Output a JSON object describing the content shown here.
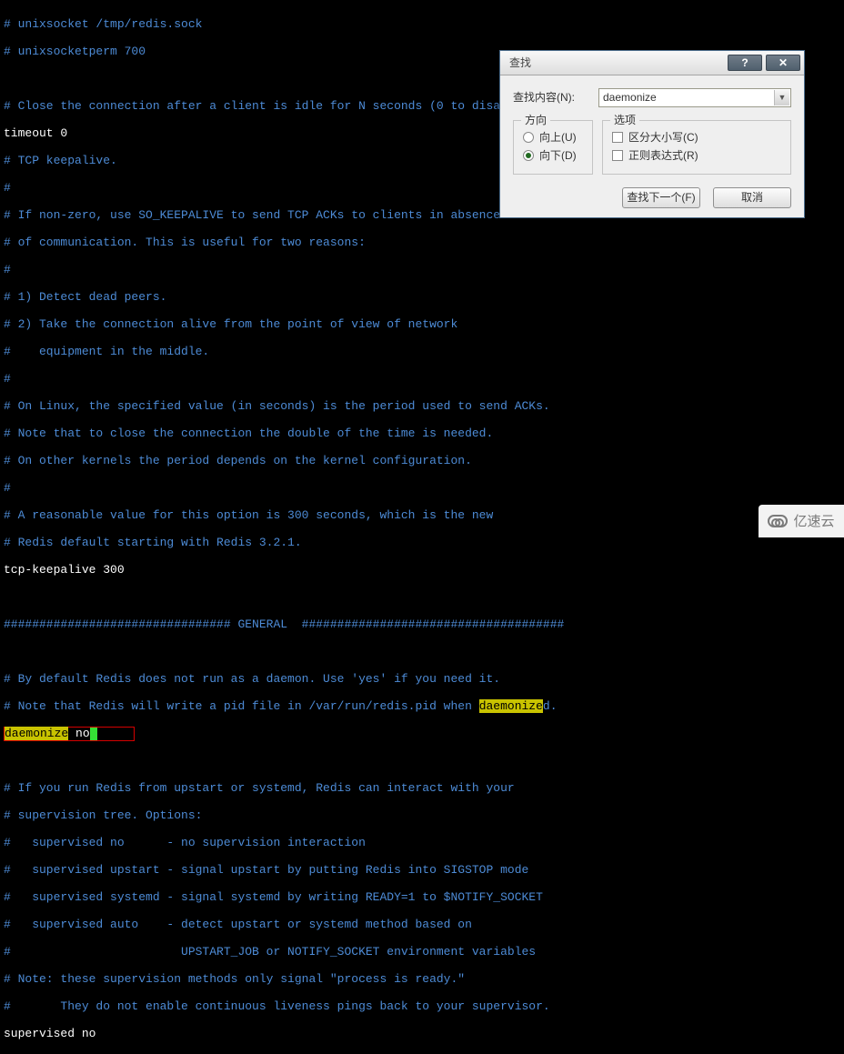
{
  "terminal": {
    "l1": "# unixsocket /tmp/redis.sock",
    "l2": "# unixsocketperm 700",
    "l3": "",
    "l4": "# Close the connection after a client is idle for N seconds (0 to disable)",
    "l5": "timeout 0",
    "l6": "# TCP keepalive.",
    "l7": "#",
    "l8": "# If non-zero, use SO_KEEPALIVE to send TCP ACKs to clients in absence",
    "l9": "# of communication. This is useful for two reasons:",
    "l10": "#",
    "l11": "# 1) Detect dead peers.",
    "l12": "# 2) Take the connection alive from the point of view of network",
    "l13": "#    equipment in the middle.",
    "l14": "#",
    "l15": "# On Linux, the specified value (in seconds) is the period used to send ACKs.",
    "l16": "# Note that to close the connection the double of the time is needed.",
    "l17": "# On other kernels the period depends on the kernel configuration.",
    "l18": "#",
    "l19": "# A reasonable value for this option is 300 seconds, which is the new",
    "l20": "# Redis default starting with Redis 3.2.1.",
    "l21": "tcp-keepalive 300",
    "l22": "",
    "divider": "################################ GENERAL  #####################################",
    "l24": "",
    "l25": "# By default Redis does not run as a daemon. Use 'yes' if you need it.",
    "l26a": "# Note that Redis will write a pid file in /var/run/redis.pid when ",
    "l26b": "daemonize",
    "l26c": "d.",
    "l27a": "daemonize",
    "l27b": " no",
    "l28": "",
    "l29": "# If you run Redis from upstart or systemd, Redis can interact with your",
    "l30": "# supervision tree. Options:",
    "l31": "#   supervised no      - no supervision interaction",
    "l32": "#   supervised upstart - signal upstart by putting Redis into SIGSTOP mode",
    "l33": "#   supervised systemd - signal systemd by writing READY=1 to $NOTIFY_SOCKET",
    "l34": "#   supervised auto    - detect upstart or systemd method based on",
    "l35": "#                        UPSTART_JOB or NOTIFY_SOCKET environment variables",
    "l36": "# Note: these supervision methods only signal \"process is ready.\"",
    "l37": "#       They do not enable continuous liveness pings back to your supervisor.",
    "l38": "supervised no"
  },
  "find": {
    "title": "查找",
    "help": "?",
    "close": "✕",
    "label_content": "查找内容(N):",
    "value": "daemonize",
    "group_direction": "方向",
    "dir_up": "向上(U)",
    "dir_down": "向下(D)",
    "group_options": "选项",
    "opt_case": "区分大小写(C)",
    "opt_regex": "正则表达式(R)",
    "btn_next": "查找下一个(F)",
    "btn_cancel": "取消"
  },
  "watermark": "亿速云"
}
